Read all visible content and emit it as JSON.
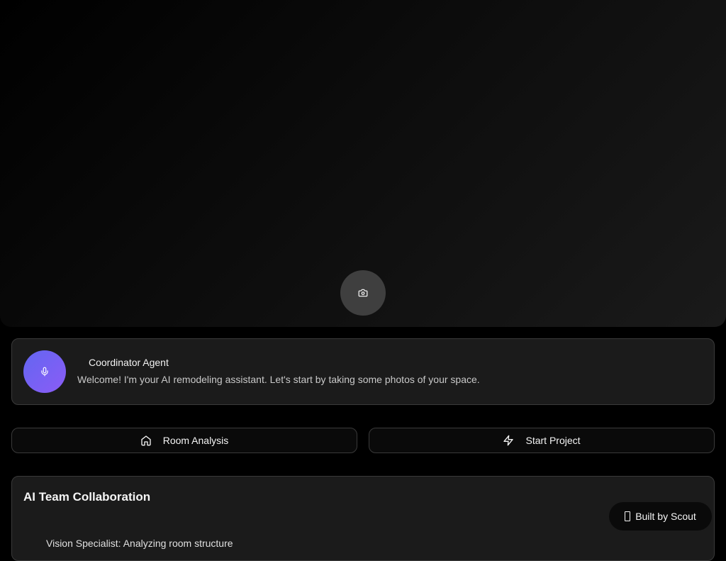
{
  "camera": {
    "icon": "camera-icon"
  },
  "agent": {
    "icon": "mic-icon",
    "name": "Coordinator Agent",
    "message": "Welcome! I'm your AI remodeling assistant. Let's start by taking some photos of your space.",
    "avatar_gradient": [
      "#6366f1",
      "#8b5cf6"
    ]
  },
  "actions": {
    "room_analysis": {
      "label": "Room Analysis",
      "icon": "home-icon"
    },
    "start_project": {
      "label": "Start Project",
      "icon": "lightning-icon"
    }
  },
  "collaboration": {
    "title": "AI Team Collaboration",
    "items": [
      "Vision Specialist: Analyzing room structure"
    ]
  },
  "badge": {
    "label": "Built by Scout",
    "icon": "scout-icon"
  }
}
